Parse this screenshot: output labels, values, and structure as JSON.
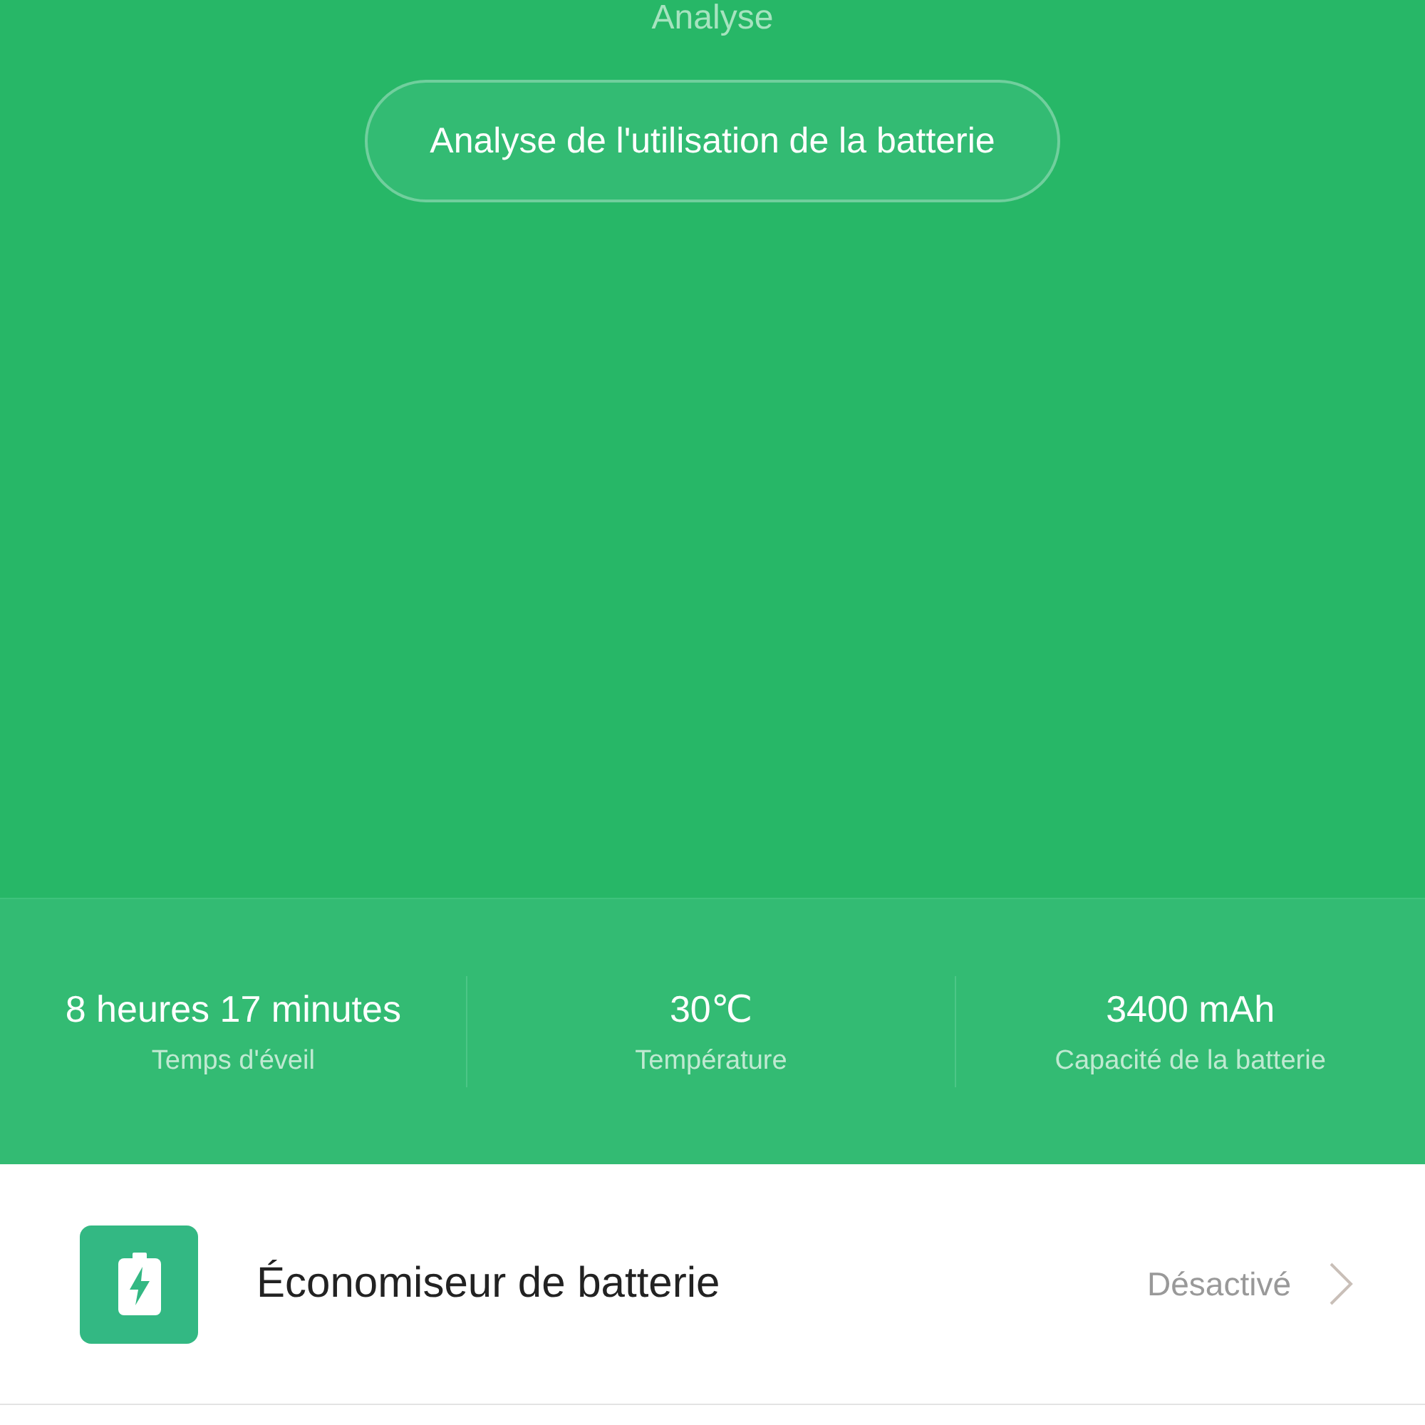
{
  "header": {
    "title": "Analyse",
    "button": "Analyse de l'utilisation de la batterie"
  },
  "stats": [
    {
      "value": "8 heures 17 minutes",
      "label": "Temps d'éveil"
    },
    {
      "value": "30℃",
      "label": "Température"
    },
    {
      "value": "3400 mAh",
      "label": "Capacité de la batterie"
    }
  ],
  "settings": [
    {
      "title": "Économiseur de batterie",
      "status": "Désactivé"
    }
  ]
}
